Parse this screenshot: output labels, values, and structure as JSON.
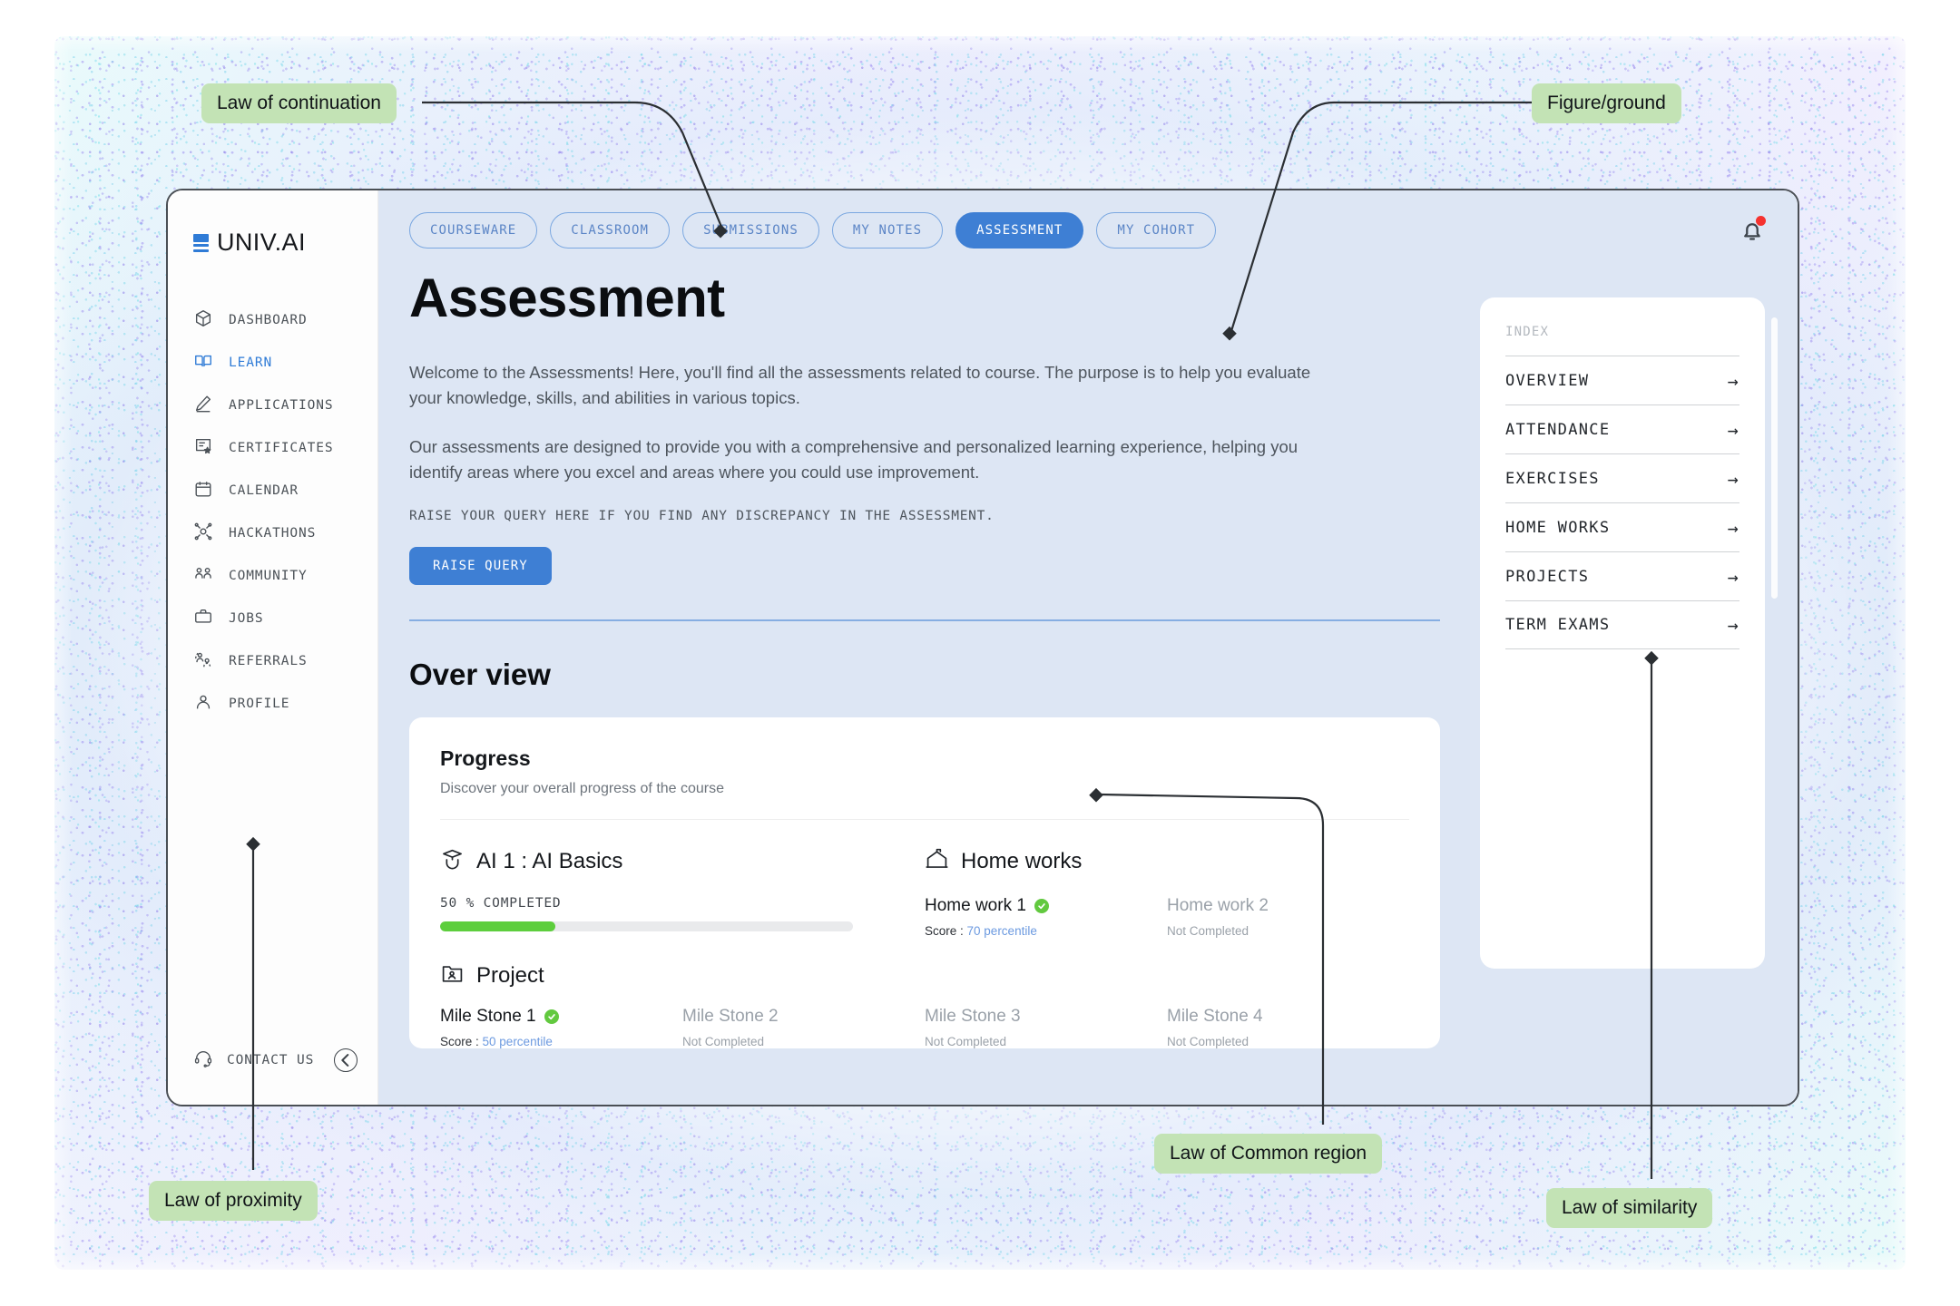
{
  "brand": {
    "name": "UNIV.AI",
    "logo_icon": "univ-ai-logo-icon"
  },
  "sidebar": {
    "items": [
      {
        "label": "DASHBOARD",
        "icon": "cube-icon",
        "active": false
      },
      {
        "label": "LEARN",
        "icon": "book-open-icon",
        "active": true
      },
      {
        "label": "APPLICATIONS",
        "icon": "pencil-icon",
        "active": false
      },
      {
        "label": "CERTIFICATES",
        "icon": "certificate-icon",
        "active": false
      },
      {
        "label": "CALENDAR",
        "icon": "calendar-icon",
        "active": false
      },
      {
        "label": "HACKATHONS",
        "icon": "hackathon-icon",
        "active": false
      },
      {
        "label": "COMMUNITY",
        "icon": "people-icon",
        "active": false
      },
      {
        "label": "JOBS",
        "icon": "briefcase-icon",
        "active": false
      },
      {
        "label": "REFERRALS",
        "icon": "referral-icon",
        "active": false
      },
      {
        "label": "PROFILE",
        "icon": "person-icon",
        "active": false
      }
    ],
    "contact_label": "CONTACT US",
    "contact_icon": "headset-icon",
    "collapse_icon": "arrow-left-circle-icon"
  },
  "topbar": {
    "tabs": [
      {
        "label": "COURSEWARE",
        "active": false
      },
      {
        "label": "CLASSROOM",
        "active": false
      },
      {
        "label": "SUBMISSIONS",
        "active": false
      },
      {
        "label": "MY NOTES",
        "active": false
      },
      {
        "label": "ASSESSMENT",
        "active": true
      },
      {
        "label": "MY COHORT",
        "active": false
      }
    ],
    "bell_icon": "bell-icon",
    "has_notification": true
  },
  "main": {
    "page_title": "Assessment",
    "paragraph_1": "Welcome to the Assessments! Here, you'll find  all the assessments related to course. The purpose is to help you evaluate your knowledge, skills, and abilities in various topics.",
    "paragraph_2": "Our assessments are designed to provide you with a comprehensive and personalized learning experience, helping you identify areas where you excel and areas where you could use improvement.",
    "query_note": "RAISE YOUR QUERY HERE IF YOU FIND ANY DISCREPANCY IN THE ASSESSMENT.",
    "raise_query_label": "RAISE QUERY",
    "overview_heading": "Over view"
  },
  "progress_card": {
    "title": "Progress",
    "subtitle": "Discover your overall progress of the course",
    "course": {
      "icon": "graduation-cap-icon",
      "name": "AI 1 : AI Basics",
      "completed_label": "50 % COMPLETED",
      "percent": 50,
      "bar_fill_percent": 28,
      "bar_color": "#5dce3d"
    },
    "home_works": {
      "icon": "school-house-icon",
      "title": "Home works",
      "items": [
        {
          "name": "Home work 1",
          "completed": true,
          "status": "Score : 70 percentile",
          "score_prefix": "Score : ",
          "score_value": "70 percentile"
        },
        {
          "name": "Home work 2",
          "completed": false,
          "status": "Not Completed"
        }
      ]
    },
    "project": {
      "icon": "folder-person-icon",
      "title": "Project",
      "items": [
        {
          "name": "Mile Stone 1",
          "completed": true,
          "status": "Score : 50 percentile",
          "score_prefix": "Score : ",
          "score_value": "50 percentile"
        },
        {
          "name": "Mile Stone 2",
          "completed": false,
          "status": "Not Completed"
        },
        {
          "name": "Mile Stone 3",
          "completed": false,
          "status": "Not Completed"
        },
        {
          "name": "Mile Stone 4",
          "completed": false,
          "status": "Not Completed"
        }
      ]
    }
  },
  "index_panel": {
    "title": "INDEX",
    "items": [
      {
        "label": "OVERVIEW",
        "icon": "arrow-right-icon"
      },
      {
        "label": "ATTENDANCE",
        "icon": "arrow-right-icon"
      },
      {
        "label": "EXERCISES",
        "icon": "arrow-right-icon"
      },
      {
        "label": "HOME WORKS",
        "icon": "arrow-right-icon"
      },
      {
        "label": "PROJECTS",
        "icon": "arrow-right-icon"
      },
      {
        "label": "TERM EXAMS",
        "icon": "arrow-right-icon"
      }
    ]
  },
  "annotations": [
    {
      "id": "continuation",
      "label": "Law of continuation"
    },
    {
      "id": "figure_ground",
      "label": "Figure/ground"
    },
    {
      "id": "common_region",
      "label": "Law of Common region"
    },
    {
      "id": "proximity",
      "label": "Law of proximity"
    },
    {
      "id": "similarity",
      "label": "Law of similarity"
    }
  ],
  "colors": {
    "accent_blue": "#3e7fd4",
    "tab_border": "#7aa7e0",
    "canvas_bg": "#dde6f4",
    "annotation_bg": "#c3e3b5",
    "progress_green": "#5dce3d",
    "notification_red": "#f5322f"
  }
}
